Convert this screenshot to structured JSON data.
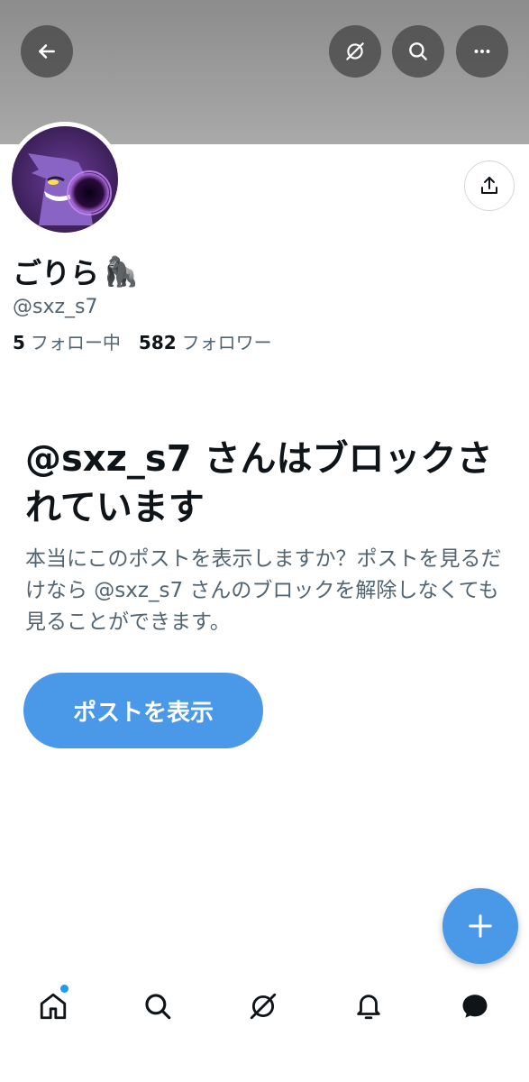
{
  "header": {
    "back_icon": "arrow-left-icon",
    "grok_icon": "grok-icon",
    "search_icon": "search-icon",
    "more_icon": "more-horizontal-icon",
    "banner_color": "#9c9c9c"
  },
  "profile": {
    "display_name": "ごりら",
    "name_emoji": "🦍",
    "handle": "@sxz_s7",
    "following_count": "5",
    "following_label": "フォロー中",
    "followers_count": "582",
    "followers_label": "フォロワー",
    "share_icon": "share-icon"
  },
  "blocked": {
    "title": "@sxz_s7 さんはブロックされています",
    "description": "本当にこのポストを表示しますか？ポストを見るだけなら @sxz_s7 さんのブロックを解除しなくても見ることができます。",
    "view_button_label": "ポストを表示"
  },
  "fab": {
    "icon": "plus-icon"
  },
  "bottom_nav": {
    "items": [
      {
        "icon": "home-icon",
        "has_badge": true
      },
      {
        "icon": "search-icon"
      },
      {
        "icon": "grok-icon"
      },
      {
        "icon": "bell-icon"
      },
      {
        "icon": "messages-icon"
      }
    ]
  },
  "colors": {
    "accent": "#4a99e9",
    "text_primary": "#0f1419",
    "text_secondary": "#536471",
    "badge": "#1d9bf0"
  }
}
